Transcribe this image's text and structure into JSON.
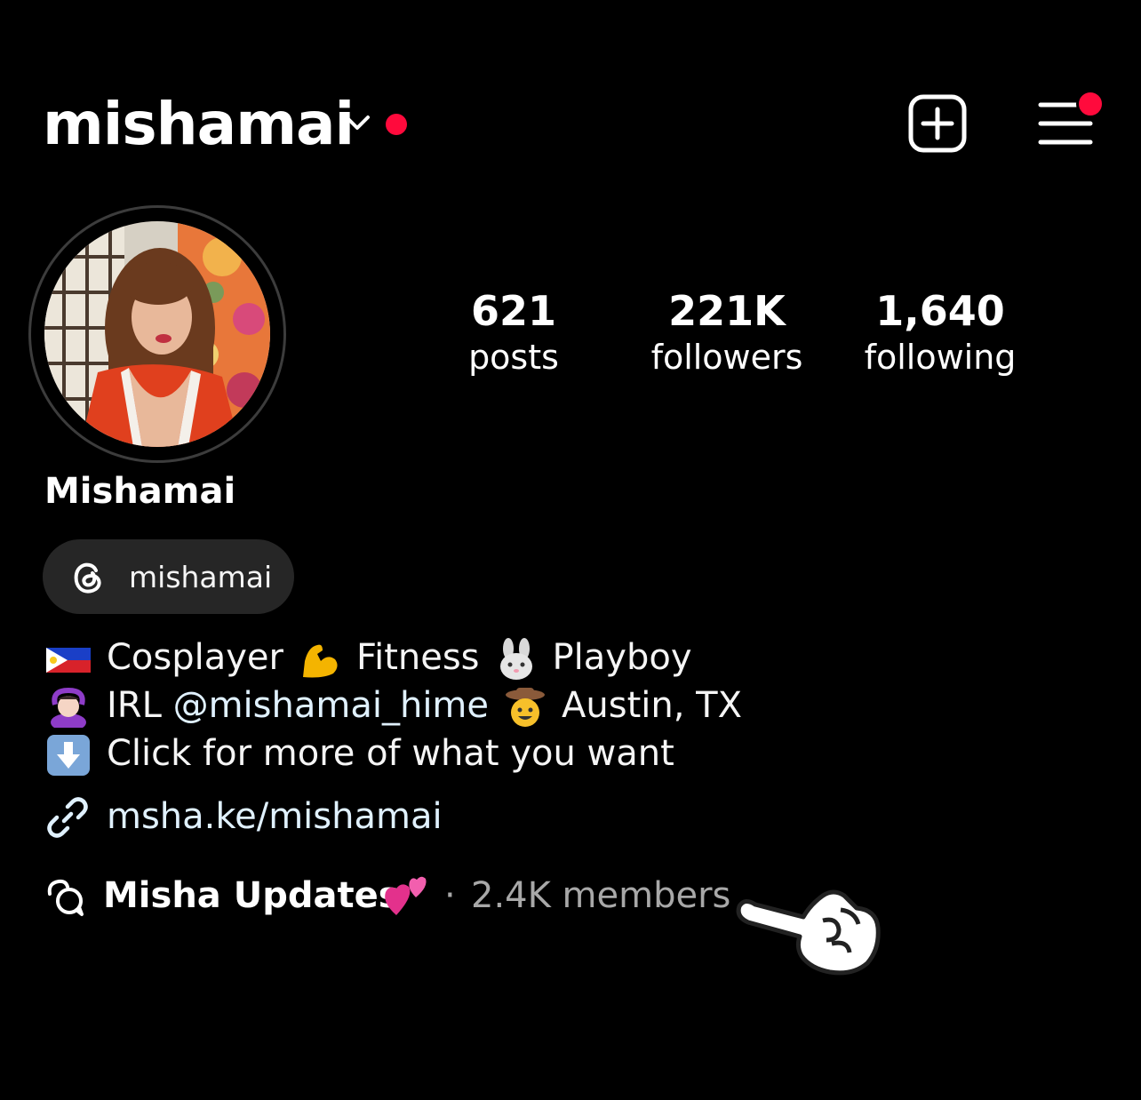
{
  "header": {
    "username": "mishamai",
    "icons": [
      "chevron-down-icon",
      "new-post-icon",
      "menu-icon"
    ],
    "accent_color": "#ff0a3c"
  },
  "stats": [
    {
      "value": "621",
      "label": "posts"
    },
    {
      "value": "221K",
      "label": "followers"
    },
    {
      "value": "1,640",
      "label": "following"
    }
  ],
  "profile": {
    "display_name": "Mishamai",
    "threads_handle": "mishamai"
  },
  "bio": {
    "line1": {
      "a": "Cosplayer",
      "b": "Fitness",
      "c": "Playboy"
    },
    "line2": {
      "prefix": "IRL ",
      "mention": "@mishamai_hime",
      "place": "Austin, TX"
    },
    "line3": {
      "text": "Click for more of what you want"
    }
  },
  "link": {
    "text": "msha.ke/mishamai"
  },
  "channel": {
    "name": "Misha Updates",
    "separator": "·",
    "members": "2.4K members"
  }
}
